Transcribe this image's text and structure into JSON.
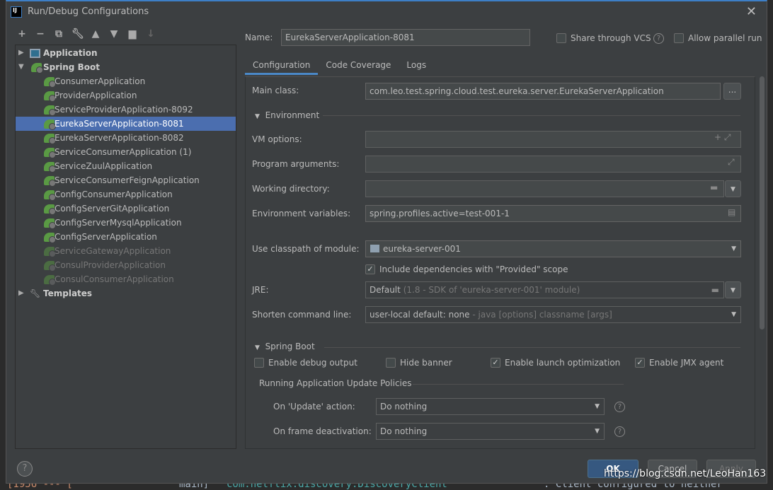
{
  "window": {
    "title": "Run/Debug Configurations",
    "logo": "IJ"
  },
  "toolbar": [
    "add-icon",
    "remove-icon",
    "copy-icon",
    "wrench-icon",
    "move-up-icon",
    "move-down-icon",
    "new-folder-icon",
    "sort-icon"
  ],
  "tree": {
    "groups": [
      {
        "label": "Application"
      },
      {
        "label": "Spring Boot"
      },
      {
        "label": "Templates"
      }
    ],
    "items": [
      {
        "label": "ConsumerApplication",
        "dim": false
      },
      {
        "label": "ProviderApplication",
        "dim": false
      },
      {
        "label": "ServiceProviderApplication-8092",
        "dim": false
      },
      {
        "label": "EurekaServerApplication-8081",
        "dim": false,
        "selected": true
      },
      {
        "label": "EurekaServerApplication-8082",
        "dim": false
      },
      {
        "label": "ServiceConsumerApplication (1)",
        "dim": false
      },
      {
        "label": "ServiceZuulApplication",
        "dim": false
      },
      {
        "label": "ServiceConsumerFeignApplication",
        "dim": false
      },
      {
        "label": "ConfigConsumerApplication",
        "dim": false
      },
      {
        "label": "ConfigServerGitApplication",
        "dim": false
      },
      {
        "label": "ConfigServerMysqlApplication",
        "dim": false
      },
      {
        "label": "ConfigServerApplication",
        "dim": false
      },
      {
        "label": "ServiceGatewayApplication",
        "dim": true
      },
      {
        "label": "ConsulProviderApplication",
        "dim": true
      },
      {
        "label": "ConsulConsumerApplication",
        "dim": true
      }
    ]
  },
  "header": {
    "name_label": "Name:",
    "name_value": "EurekaServerApplication-8081",
    "share_label": "Share through VCS",
    "share_checked": false,
    "parallel_label": "Allow parallel run",
    "parallel_checked": false
  },
  "tabs": [
    {
      "label": "Configuration",
      "active": true
    },
    {
      "label": "Code Coverage"
    },
    {
      "label": "Logs"
    }
  ],
  "config": {
    "main_class_label": "Main class:",
    "main_class": "com.leo.test.spring.cloud.test.eureka.server.EurekaServerApplication",
    "browse": "...",
    "environment_title": "Environment",
    "vm_label": "VM options:",
    "vm_value": "",
    "args_label": "Program arguments:",
    "args_value": "",
    "workdir_label": "Working directory:",
    "workdir_value": "",
    "envvars_label": "Environment variables:",
    "envvars_value": "spring.profiles.active=test-001-1",
    "classpath_label": "Use classpath of module:",
    "classpath_value": "eureka-server-001",
    "include_label": "Include dependencies with \"Provided\" scope",
    "include_checked": true,
    "jre_label": "JRE:",
    "jre_value": "Default",
    "jre_hint": "(1.8 - SDK of 'eureka-server-001' module)",
    "shorten_label": "Shorten command line:",
    "shorten_value": "user-local default: none",
    "shorten_hint": "- java [options] classname [args]",
    "spring_title": "Spring Boot",
    "debug_label": "Enable debug output",
    "debug_checked": false,
    "banner_label": "Hide banner",
    "banner_checked": false,
    "launch_label": "Enable launch optimization",
    "launch_checked": true,
    "jmx_label": "Enable JMX agent",
    "jmx_checked": true,
    "policies_title": "Running Application Update Policies",
    "update_label": "On 'Update' action:",
    "update_value": "Do nothing",
    "frame_label": "On frame deactivation:",
    "frame_value": "Do nothing"
  },
  "buttons": {
    "ok": "OK",
    "cancel": "Cancel",
    "apply": "Apply",
    "help": "?"
  },
  "watermark": "https://blog.csdn.net/LeoHan163",
  "background_console": [
    "[1956 --- [",
    "main]",
    "com.netflix.discovery.DiscoveryClient",
    ": Client configured to neither"
  ]
}
